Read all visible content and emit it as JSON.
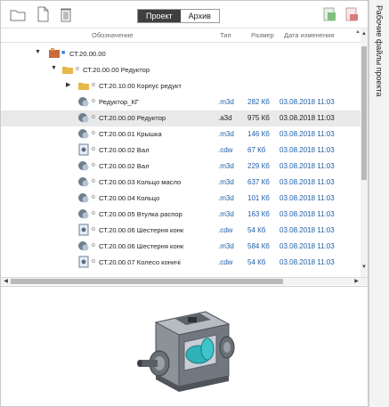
{
  "toolbar": {
    "left_icons": [
      "folder-icon",
      "new-file-icon",
      "trash-icon"
    ],
    "right_icons": [
      "export-icon",
      "pdf-icon"
    ],
    "tabs": [
      {
        "label": "Проект",
        "active": true
      },
      {
        "label": "Архив",
        "active": false
      }
    ]
  },
  "columns": {
    "name": "Обозначение",
    "type": "Тип",
    "size": "Размер",
    "date": "Дата изменения"
  },
  "tree": [
    {
      "label": "СТ.20.00.00"
    },
    {
      "label": "СТ.20.00.00 Редуктор"
    },
    {
      "label": "СТ.20.10.00 Корпус редукт"
    }
  ],
  "files": [
    {
      "name": "Редуктор_КГ",
      "ext": ".m3d",
      "size": "282 Кб",
      "date": "03.08.2018 11:03",
      "kind": "3d"
    },
    {
      "name": "СТ.20.00.00 Редуктор",
      "ext": ".a3d",
      "size": "975 Кб",
      "date": "03.08.2018 11:03",
      "kind": "3d"
    },
    {
      "name": "СТ.20.00.01 Крышка",
      "ext": ".m3d",
      "size": "146 Кб",
      "date": "03.08.2018 11:03",
      "kind": "3d"
    },
    {
      "name": "СТ.20.00.02 Вал",
      "ext": ".cdw",
      "size": "67 Кб",
      "date": "03.08.2018 11:03",
      "kind": "drawing"
    },
    {
      "name": "СТ.20.00.02 Вал",
      "ext": ".m3d",
      "size": "229 Кб",
      "date": "03.08.2018 11:03",
      "kind": "3d"
    },
    {
      "name": "СТ.20.00.03 Кольцо масло",
      "ext": ".m3d",
      "size": "637 Кб",
      "date": "03.08.2018 11:03",
      "kind": "3d"
    },
    {
      "name": "СТ.20.00.04 Кольцо",
      "ext": ".m3d",
      "size": "101 Кб",
      "date": "03.08.2018 11:03",
      "kind": "3d"
    },
    {
      "name": "СТ.20.00.05 Втулка распор",
      "ext": ".m3d",
      "size": "163 Кб",
      "date": "03.08.2018 11:03",
      "kind": "3d"
    },
    {
      "name": "СТ.20.00.06 Шестерня конк",
      "ext": ".cdw",
      "size": "54 Кб",
      "date": "03.08.2018 11:03",
      "kind": "drawing"
    },
    {
      "name": "СТ.20.00.06 Шестерня конк",
      "ext": ".m3d",
      "size": "584 Кб",
      "date": "03.08.2018 11:03",
      "kind": "3d"
    },
    {
      "name": "СТ.20.00.07 Колесо коничі",
      "ext": ".cdw",
      "size": "54 Кб",
      "date": "03.08.2018 11:03",
      "kind": "drawing"
    }
  ],
  "side_panel": {
    "label": "Рабочие файлы проекта"
  },
  "colors": {
    "accent": "#1f5fa8",
    "tab_active": "#3f3f3f",
    "folder": "#e6b84a"
  }
}
